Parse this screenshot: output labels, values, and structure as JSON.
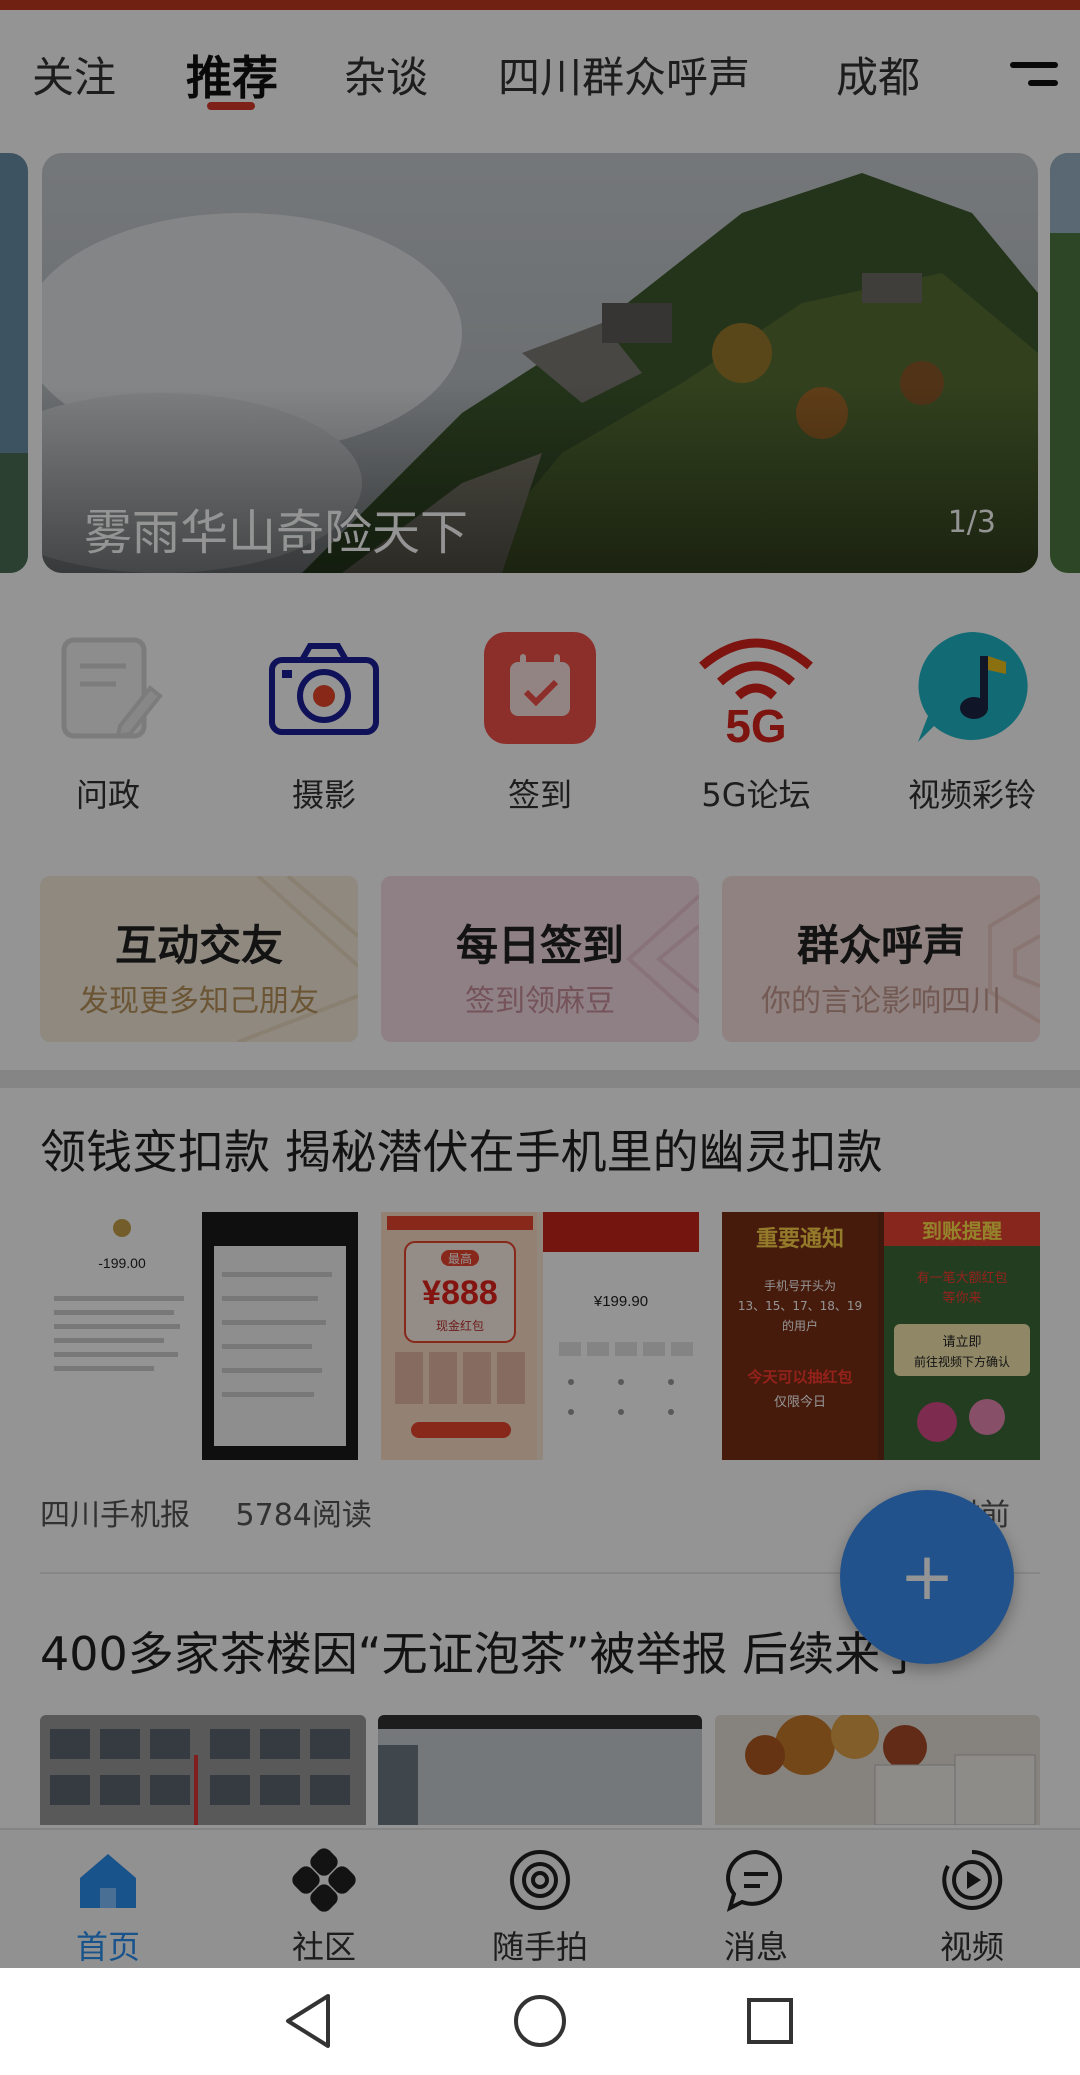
{
  "tabs": [
    {
      "label": "关注",
      "active": false
    },
    {
      "label": "推荐",
      "active": true
    },
    {
      "label": "杂谈",
      "active": false
    },
    {
      "label": "四川群众呼声",
      "active": false
    },
    {
      "label": "成都",
      "active": false
    }
  ],
  "menu_icon": "menu-icon",
  "banner": {
    "title": "雾雨华山奇险天下",
    "page_indicator": "1/3"
  },
  "quick_links": [
    {
      "label": "问政",
      "icon": "edit-document-icon"
    },
    {
      "label": "摄影",
      "icon": "camera-icon"
    },
    {
      "label": "签到",
      "icon": "calendar-check-icon"
    },
    {
      "label": "5G论坛",
      "icon": "5g-signal-icon"
    },
    {
      "label": "视频彩铃",
      "icon": "music-note-icon"
    }
  ],
  "promo_cards": [
    {
      "title": "互动交友",
      "subtitle": "发现更多知己朋友",
      "color": "#f7eddc",
      "accent": "#b8935a"
    },
    {
      "title": "每日签到",
      "subtitle": "签到领麻豆",
      "color": "#f6dde6",
      "accent": "#c9909e"
    },
    {
      "title": "群众呼声",
      "subtitle": "你的言论影响四川",
      "color": "#f7e0dc",
      "accent": "#c79a90"
    }
  ],
  "articles": [
    {
      "title": "领钱变扣款 揭秘潜伏在手机里的幽灵扣款",
      "source": "四川手机报",
      "reads": "5784阅读",
      "time": "时前",
      "thumb_texts": {
        "amount1": "-199.00",
        "amount2": "¥888",
        "label_zuigao": "最高",
        "label_xianjin": "现金红包",
        "amount3": "¥199.90",
        "notice1": "重要通知",
        "notice1_body": "手机号开头为\n13、15、17、18、19\n的用户",
        "notice1_cta": "今天可以抽红包",
        "notice1_sub": "仅限今日",
        "notice2": "到账提醒",
        "notice2_body": "有一笔大额红包\n等你来",
        "notice2_cta": "请立即\n前往视频下方确认"
      }
    },
    {
      "title": "400多家茶楼因“无证泡茶”被举报 后续来了"
    }
  ],
  "fab_label": "+",
  "bottom_nav": [
    {
      "label": "首页",
      "icon": "home-icon",
      "active": true
    },
    {
      "label": "社区",
      "icon": "community-icon",
      "active": false
    },
    {
      "label": "随手拍",
      "icon": "camera-lens-icon",
      "active": false
    },
    {
      "label": "消息",
      "icon": "message-bubble-icon",
      "active": false
    },
    {
      "label": "视频",
      "icon": "video-play-icon",
      "active": false
    }
  ],
  "colors": {
    "accent_red": "#d93a2b",
    "brand_blue": "#2b8ff0",
    "fab_blue": "#3c8df0"
  }
}
